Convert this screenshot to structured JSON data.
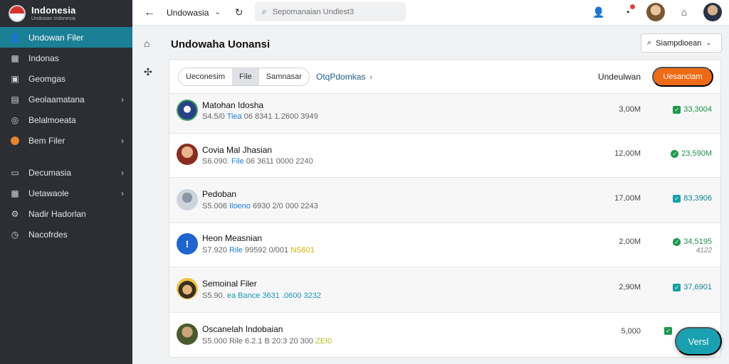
{
  "brand": {
    "title": "Indonesia",
    "subtitle": "Undowan Indonesia"
  },
  "sidebar": {
    "items": [
      {
        "label": "Undowan Filer",
        "icon": "user-icon",
        "active": true,
        "chevron": false
      },
      {
        "label": "Indonas",
        "icon": "grid-icon",
        "active": false,
        "chevron": false
      },
      {
        "label": "Geomgas",
        "icon": "image-icon",
        "active": false,
        "chevron": false
      },
      {
        "label": "Geolaamatana",
        "icon": "calendar-icon",
        "active": false,
        "chevron": true
      },
      {
        "label": "Belalmoeata",
        "icon": "globe-icon",
        "active": false,
        "chevron": false
      },
      {
        "label": "Bem Filer",
        "icon": "orange-circle-icon",
        "active": false,
        "chevron": true
      },
      {
        "label": "Decumasia",
        "icon": "folder-icon",
        "active": false,
        "chevron": true
      },
      {
        "label": "Uetawaole",
        "icon": "grid-icon",
        "active": false,
        "chevron": true
      },
      {
        "label": "Nadir Hadorlan",
        "icon": "gear-icon",
        "active": false,
        "chevron": false
      },
      {
        "label": "Nacofrdes",
        "icon": "clock-icon",
        "active": false,
        "chevron": false
      }
    ]
  },
  "topbar": {
    "title": "Undowasia",
    "search_placeholder": "Sepomanaian Undlest3"
  },
  "page": {
    "title": "Undowaha Uonansi",
    "sort_label": "Siampdioean"
  },
  "panel": {
    "segments": [
      "Ueconesim",
      "File",
      "Samnasar"
    ],
    "selected_segment": 1,
    "breadcrumb": "OtqPdomkas",
    "head_label": "Undeulwan",
    "cta_label": "Uesanclam"
  },
  "rows": [
    {
      "name": "Matohan Idosha",
      "meta_pre": "S4.5/0",
      "meta_tag": "Tiea",
      "meta_post": "06 8341 1.2600 3949",
      "tag_color": "blue",
      "size": "3,00M",
      "status": "33,3004",
      "status_shape": "check-square",
      "sub_status": ""
    },
    {
      "name": "Covia Mal Jhasian",
      "meta_pre": "S6.090.",
      "meta_tag": "File",
      "meta_post": "06 3611 0000 2240",
      "tag_color": "blue",
      "size": "12,00M",
      "status": "23,590M",
      "status_shape": "check-circle",
      "sub_status": ""
    },
    {
      "name": "Pedoban",
      "meta_pre": "S5.006",
      "meta_tag": "Iloeno",
      "meta_post": "6930 2/0 000 2243",
      "tag_color": "blue",
      "size": "17,00M",
      "status": "83,3906",
      "status_shape": "teal-square",
      "sub_status": ""
    },
    {
      "name": "Heon Measnian",
      "meta_pre": "S7.920",
      "meta_tag": "Rile",
      "meta_post": "99592 0/001",
      "tag_color": "blue",
      "tag2": "NS601",
      "size": "2,00M",
      "status": "34,5195",
      "status_shape": "check-circle",
      "sub_status": "4122"
    },
    {
      "name": "Semoinal Filer",
      "meta_pre": "S5.90.",
      "meta_tag": "ea Bance 3631 .0600 3232",
      "meta_post": "",
      "tag_color": "teal",
      "size": "2,90M",
      "status": "37,6901",
      "status_shape": "teal-square",
      "sub_status": ""
    },
    {
      "name": "Oscanelah Indobaian",
      "meta_pre": "S5.000",
      "meta_tag": "Rile",
      "meta_post": "6.2.1 B 20:3 20 300",
      "tag_color": "plain",
      "tag2": "ZEI0",
      "size": "5,000",
      "status": "",
      "status_shape": "check-square",
      "sub_status": ""
    }
  ],
  "fab_label": "Versl"
}
